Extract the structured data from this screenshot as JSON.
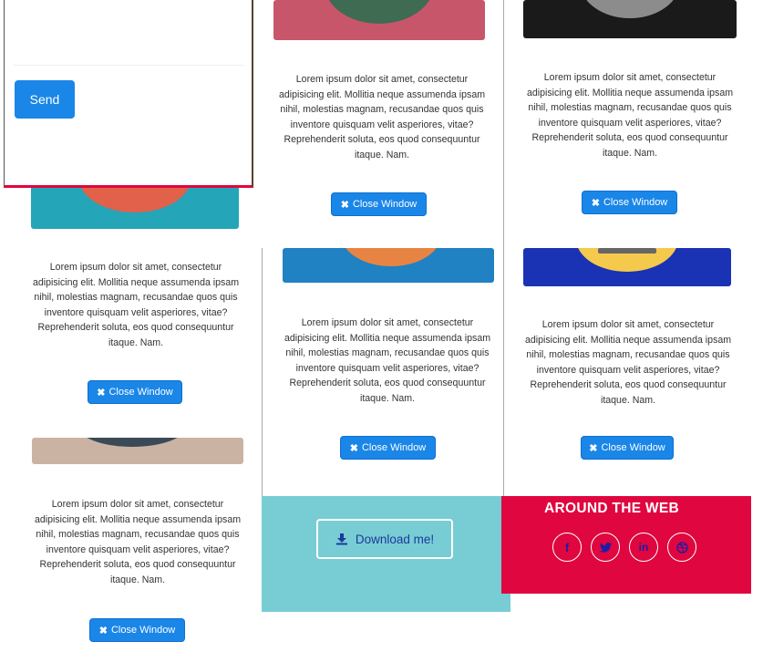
{
  "contact_form": {
    "send_label": "Send"
  },
  "portfolio": {
    "description": "Lorem ipsum dolor sit amet, consectetur adipisicing elit. Mollitia neque assumenda ipsam nihil, molestias magnam, recusandae quos quis inventore quisquam velit asperiores, vitae? Reprehenderit soluta, eos quod consequuntur itaque. Nam.",
    "close_label": "Close Window",
    "colors": {
      "button": "#1a86e8",
      "band_pink": "#c8566a",
      "band_teal": "#24a5b8",
      "band_blue": "#2081c3",
      "band_navy": "#1a33b4",
      "band_tan": "#cbb3a3",
      "band_black": "#1a1a1a"
    }
  },
  "download": {
    "label": "Download me!"
  },
  "footer": {
    "around_title": "AROUND THE WEB",
    "social_icons": [
      "facebook-icon",
      "twitter-icon",
      "linkedin-icon",
      "dribbble-icon"
    ],
    "accent": "#e0063f"
  }
}
